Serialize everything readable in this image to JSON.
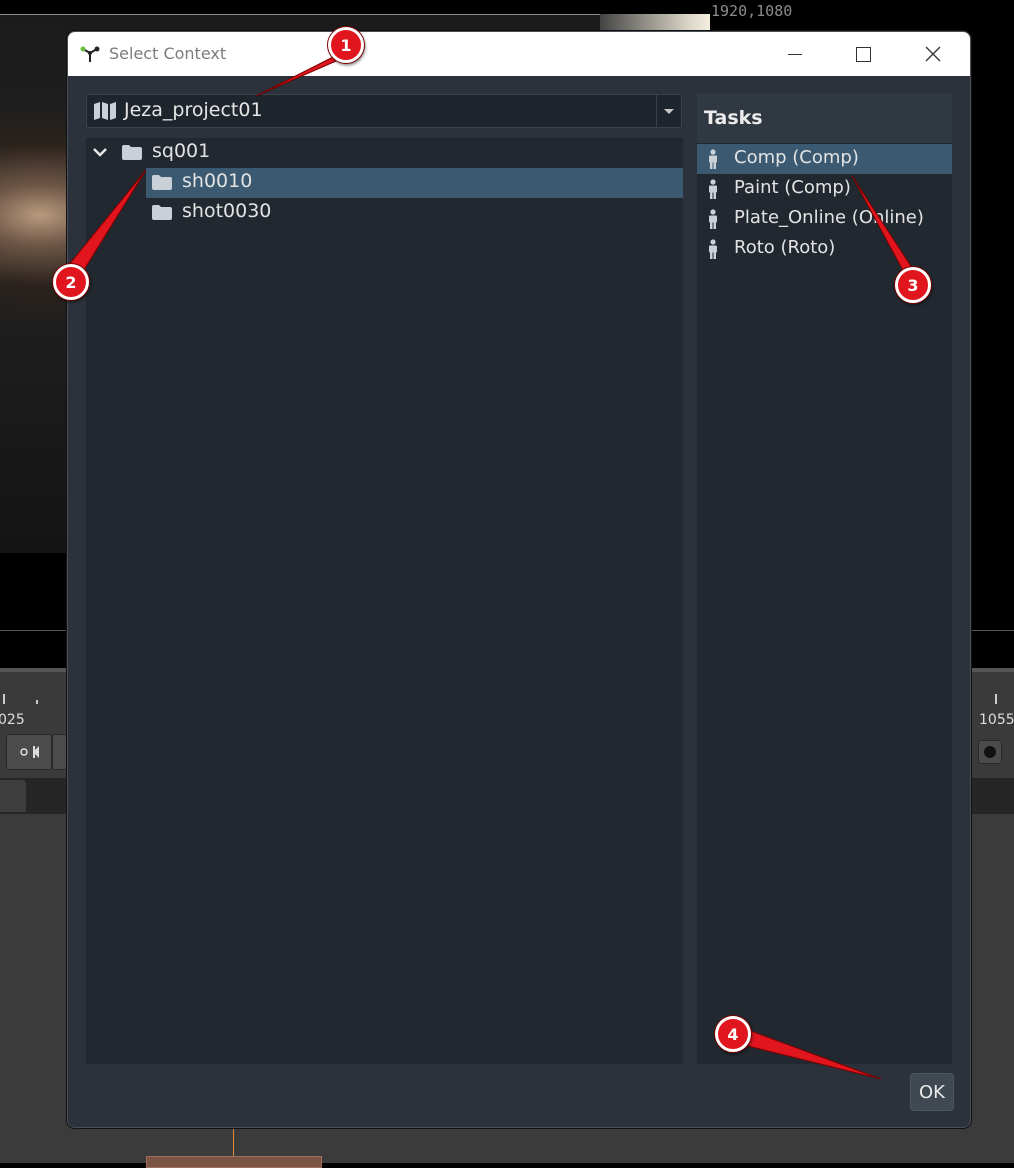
{
  "background": {
    "resolution": "1920,1080",
    "frame_left": "025",
    "frame_right": "1055"
  },
  "dialog": {
    "title": "Select Context",
    "project": "Jeza_project01",
    "tree": [
      {
        "label": "sq001",
        "expanded": true,
        "selected": false
      },
      {
        "label": "sh0010",
        "selected": true
      },
      {
        "label": "shot0030",
        "selected": false
      }
    ],
    "tasks_title": "Tasks",
    "tasks": [
      {
        "label": "Comp (Comp)",
        "selected": true
      },
      {
        "label": "Paint (Comp)",
        "selected": false
      },
      {
        "label": "Plate_Online (Online)",
        "selected": false
      },
      {
        "label": "Roto (Roto)",
        "selected": false
      }
    ],
    "ok_label": "OK"
  },
  "annotations": [
    "1",
    "2",
    "3",
    "4"
  ],
  "colors": {
    "selection": "#3b5a71",
    "annotation": "#e0151d",
    "dialog_bg": "#2b323b",
    "panel_bg": "#222830"
  }
}
